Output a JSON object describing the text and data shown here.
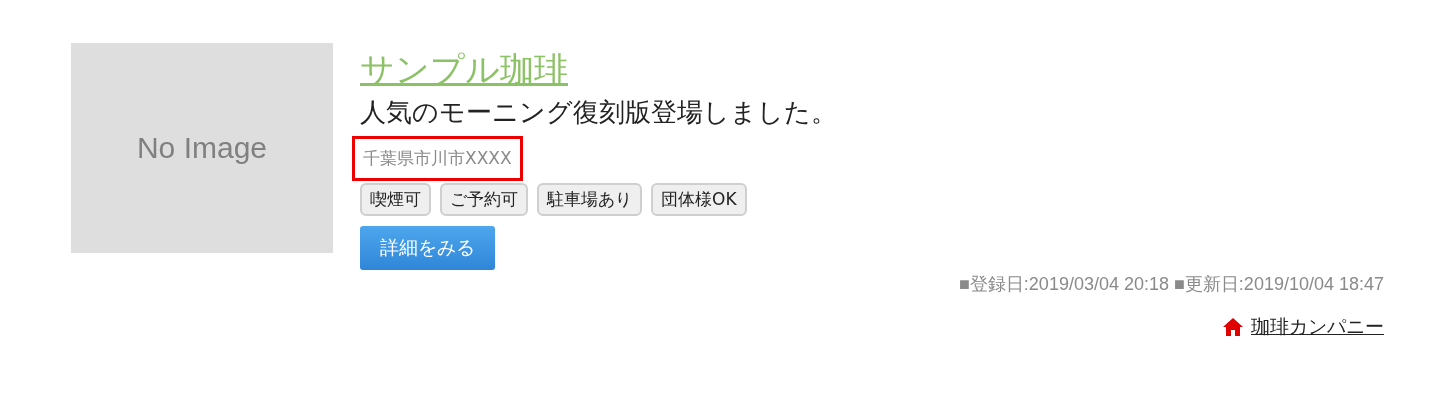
{
  "image": {
    "placeholder": "No Image"
  },
  "title": "サンプル珈琲",
  "description": "人気のモーニング復刻版登場しました。",
  "address": {
    "text": "千葉県市川市XXXX",
    "highlighted": true
  },
  "tags": [
    "喫煙可",
    "ご予約可",
    "駐車場あり",
    "団体様OK"
  ],
  "detail_button": "詳細をみる",
  "dates": "■登録日:2019/03/04 20:18 ■更新日:2019/10/04 18:47",
  "company_link": "珈琲カンパニー"
}
